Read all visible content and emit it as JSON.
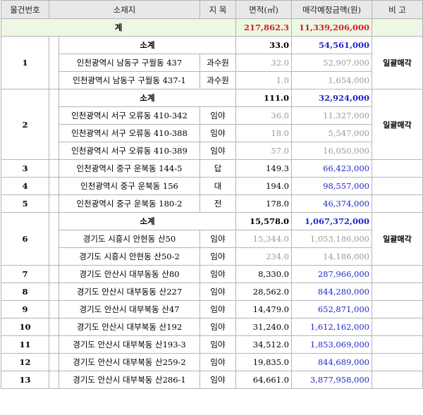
{
  "headers": {
    "lot_no": "물건번호",
    "location": "소재지",
    "category": "지 목",
    "area": "면적(㎡)",
    "price": "매각예정금액(원)",
    "remarks": "비 고"
  },
  "grand_total": {
    "label": "계",
    "area": "217,862.3",
    "price": "11,339,206,000"
  },
  "groups": [
    {
      "no": "1",
      "remark": "일괄매각",
      "subtotal": {
        "label": "소계",
        "area": "33.0",
        "price": "54,561,000"
      },
      "rows": [
        {
          "location": "인천광역시 남동구 구월동 437",
          "category": "과수원",
          "area": "32.0",
          "price": "52,907,000"
        },
        {
          "location": "인천광역시 남동구 구월동 437-1",
          "category": "과수원",
          "area": "1.0",
          "price": "1,654,000"
        }
      ]
    },
    {
      "no": "2",
      "remark": "일괄매각",
      "subtotal": {
        "label": "소계",
        "area": "111.0",
        "price": "32,924,000"
      },
      "rows": [
        {
          "location": "인천광역시 서구 오류동 410-342",
          "category": "임야",
          "area": "36.0",
          "price": "11,327,000"
        },
        {
          "location": "인천광역시 서구 오류동 410-388",
          "category": "임야",
          "area": "18.0",
          "price": "5,547,000"
        },
        {
          "location": "인천광역시 서구 오류동 410-389",
          "category": "임야",
          "area": "57.0",
          "price": "16,050,000"
        }
      ]
    },
    {
      "no": "3",
      "location": "인천광역시 중구 운북동 144-5",
      "category": "답",
      "area": "149.3",
      "price": "66,423,000"
    },
    {
      "no": "4",
      "location": "인천광역시 중구 운북동 156",
      "category": "대",
      "area": "194.0",
      "price": "98,557,000"
    },
    {
      "no": "5",
      "location": "인천광역시 중구 운북동 180-2",
      "category": "전",
      "area": "178.0",
      "price": "46,374,000"
    },
    {
      "no": "6",
      "remark": "일괄매각",
      "subtotal": {
        "label": "소계",
        "area": "15,578.0",
        "price": "1,067,372,000"
      },
      "rows": [
        {
          "location": "경기도 시흥시 안현동 산50",
          "category": "임야",
          "area": "15,344.0",
          "price": "1,053,186,000"
        },
        {
          "location": "경기도 시흥시 안현동 산50-2",
          "category": "임야",
          "area": "234.0",
          "price": "14,186,000"
        }
      ]
    },
    {
      "no": "7",
      "location": "경기도 안산시 대부동동 산80",
      "category": "임야",
      "area": "8,330.0",
      "price": "287,966,000"
    },
    {
      "no": "8",
      "location": "경기도 안산시 대부동동 산227",
      "category": "임야",
      "area": "28,562.0",
      "price": "844,280,000"
    },
    {
      "no": "9",
      "location": "경기도 안산시 대부북동 산47",
      "category": "임야",
      "area": "14,479.0",
      "price": "652,871,000"
    },
    {
      "no": "10",
      "location": "경기도 안산시 대부북동 산192",
      "category": "임야",
      "area": "31,240.0",
      "price": "1,612,162,000"
    },
    {
      "no": "11",
      "location": "경기도 안산시 대부북동 산193-3",
      "category": "임야",
      "area": "34,512.0",
      "price": "1,853,069,000"
    },
    {
      "no": "12",
      "location": "경기도 안산시 대부북동 산259-2",
      "category": "임야",
      "area": "19,835.0",
      "price": "844,689,000"
    },
    {
      "no": "13",
      "location": "경기도 안산시 대부북동 산286-1",
      "category": "임야",
      "area": "64,661.0",
      "price": "3,877,958,000"
    }
  ],
  "colors": {
    "total_bg": "#ecf7e4",
    "accent_red": "#d61f1f",
    "price_blue": "#2226c9",
    "muted_grey": "#9a9a9a",
    "header_bg": "#e8e8e8"
  }
}
